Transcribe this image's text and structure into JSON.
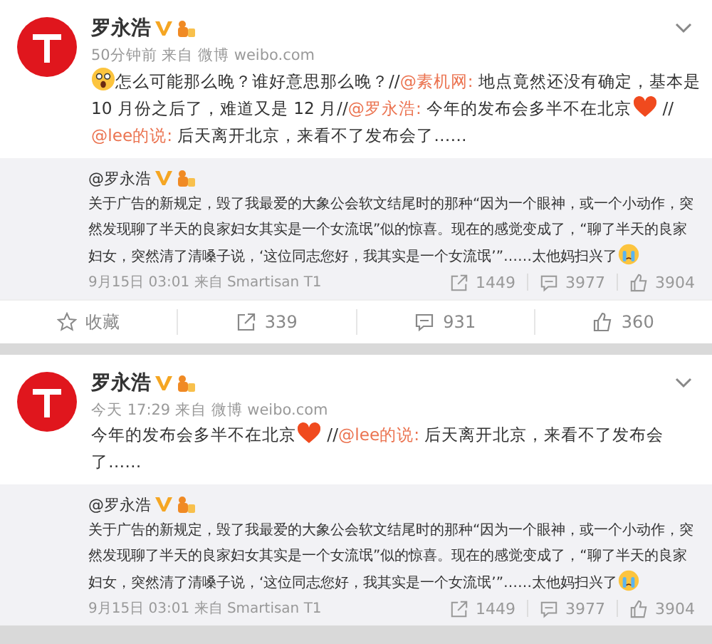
{
  "posts": [
    {
      "author": "罗永浩",
      "verified": true,
      "meta": "50分钟前 来自 微博 weibo.com",
      "text": [
        {
          "kind": "shock"
        },
        {
          "kind": "text",
          "text": "怎么可能那么晚？谁好意思那么晚？//"
        },
        {
          "kind": "mention",
          "text": "@素机网:"
        },
        {
          "kind": "text",
          "text": " 地点竟然还没有确定，基本是 10 月份之后了，难道又是 12 月//"
        },
        {
          "kind": "mention",
          "text": "@罗永浩:"
        },
        {
          "kind": "text",
          "text": " 今年的发布会多半不在北京"
        },
        {
          "kind": "heart"
        },
        {
          "kind": "text",
          "text": " //"
        },
        {
          "kind": "mention",
          "text": "@lee的说:"
        },
        {
          "kind": "text",
          "text": " 后天离开北京，来看不了发布会了……"
        }
      ],
      "quote": {
        "author": "@罗永浩",
        "verified": true,
        "text": [
          {
            "kind": "text",
            "text": "关于广告的新规定，毁了我最爱的大象公会软文结尾时的那种“因为一个眼神，或一个小动作，突然发现聊了半天的良家妇女其实是一个女流氓”似的惊喜。现在的感觉变成了，“聊了半天的良家妇女，突然清了清嗓子说，‘这位同志您好，我其实是一个女流氓’”……太他妈扫兴了"
          },
          {
            "kind": "cry"
          }
        ],
        "meta": "9月15日 03:01 来自 Smartisan T1",
        "reposts": "1449",
        "comments": "3977",
        "likes": "3904"
      },
      "actions": {
        "favorite": "收藏",
        "reposts": "339",
        "comments": "931",
        "likes": "360"
      }
    },
    {
      "author": "罗永浩",
      "verified": true,
      "meta": "今天 17:29 来自 微博 weibo.com",
      "text": [
        {
          "kind": "text",
          "text": "今年的发布会多半不在北京"
        },
        {
          "kind": "heart"
        },
        {
          "kind": "text",
          "text": " //"
        },
        {
          "kind": "mention",
          "text": "@lee的说:"
        },
        {
          "kind": "text",
          "text": " 后天离开北京，来看不了发布会了……"
        }
      ],
      "quote": {
        "author": "@罗永浩",
        "verified": true,
        "text": [
          {
            "kind": "text",
            "text": "关于广告的新规定，毁了我最爱的大象公会软文结尾时的那种“因为一个眼神，或一个小动作，突然发现聊了半天的良家妇女其实是一个女流氓”似的惊喜。现在的感觉变成了，“聊了半天的良家妇女，突然清了清嗓子说，‘这位同志您好，我其实是一个女流氓’”……太他妈扫兴了"
          },
          {
            "kind": "cry"
          }
        ],
        "meta": "9月15日 03:01 来自 Smartisan T1",
        "reposts": "1449",
        "comments": "3977",
        "likes": "3904"
      }
    }
  ]
}
